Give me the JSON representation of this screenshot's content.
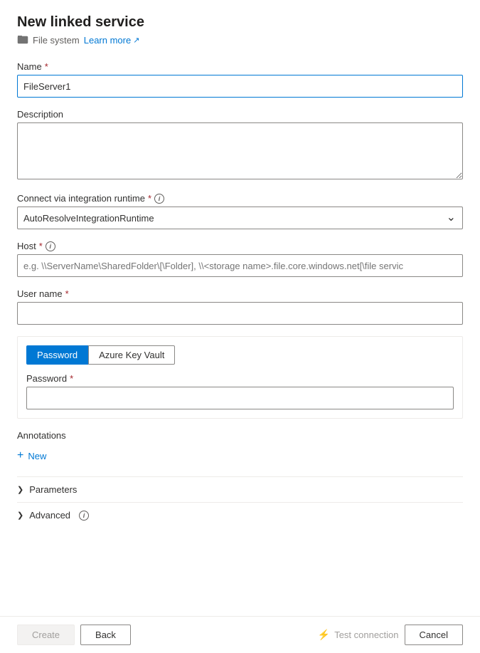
{
  "page": {
    "title": "New linked service",
    "subtitle": "File system",
    "learn_more": "Learn more"
  },
  "form": {
    "name_label": "Name",
    "name_value": "FileServer1",
    "description_label": "Description",
    "description_placeholder": "",
    "connect_runtime_label": "Connect via integration runtime",
    "connect_runtime_value": "AutoResolveIntegrationRuntime",
    "host_label": "Host",
    "host_placeholder": "e.g. \\\\ServerName\\SharedFolder\\[\\Folder], \\\\<storage name>.file.core.windows.net[\\file servic",
    "username_label": "User name",
    "username_value": "",
    "password_section": {
      "tab_password": "Password",
      "tab_azure_key_vault": "Azure Key Vault",
      "password_label": "Password",
      "password_value": ""
    },
    "annotations_label": "Annotations",
    "new_button": "New",
    "parameters_label": "Parameters",
    "advanced_label": "Advanced"
  },
  "footer": {
    "create_label": "Create",
    "back_label": "Back",
    "test_connection_label": "Test connection",
    "cancel_label": "Cancel"
  }
}
